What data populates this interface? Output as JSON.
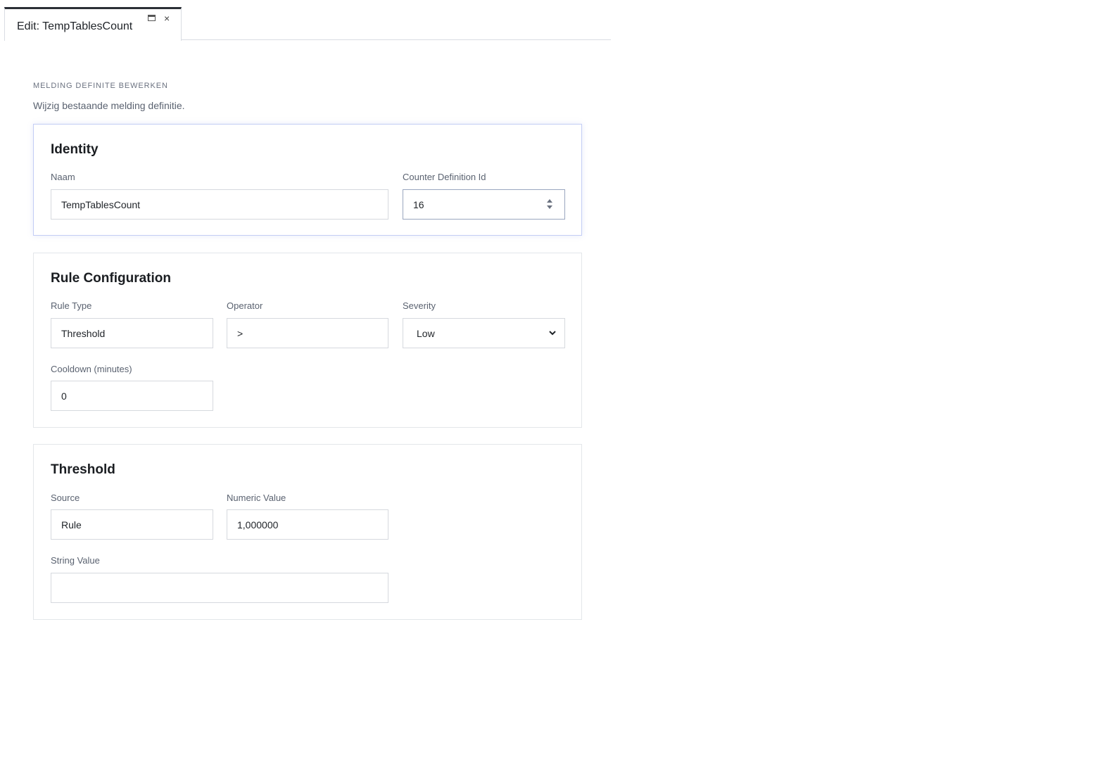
{
  "tab": {
    "title": "Edit: TempTablesCount",
    "dock_icon": "window-dock-icon",
    "close_icon": "close-icon",
    "close_glyph": "×"
  },
  "header": {
    "eyebrow": "MELDING DEFINITE BEWERKEN",
    "subtitle": "Wijzig bestaande melding definitie."
  },
  "identity": {
    "title": "Identity",
    "name_label": "Naam",
    "name_value": "TempTablesCount",
    "counter_label": "Counter Definition Id",
    "counter_value": "16"
  },
  "rule_config": {
    "title": "Rule Configuration",
    "rule_type_label": "Rule Type",
    "rule_type_value": "Threshold",
    "operator_label": "Operator",
    "operator_value": ">",
    "severity_label": "Severity",
    "severity_value": "Low",
    "cooldown_label": "Cooldown (minutes)",
    "cooldown_value": "0"
  },
  "threshold": {
    "title": "Threshold",
    "source_label": "Source",
    "source_value": "Rule",
    "numeric_label": "Numeric Value",
    "numeric_value": "1,000000",
    "string_label": "String Value",
    "string_value": ""
  },
  "colors": {
    "tab_accent": "#2b2f36",
    "focus_border": "#c3cdf5",
    "label_text": "#5a6270"
  }
}
